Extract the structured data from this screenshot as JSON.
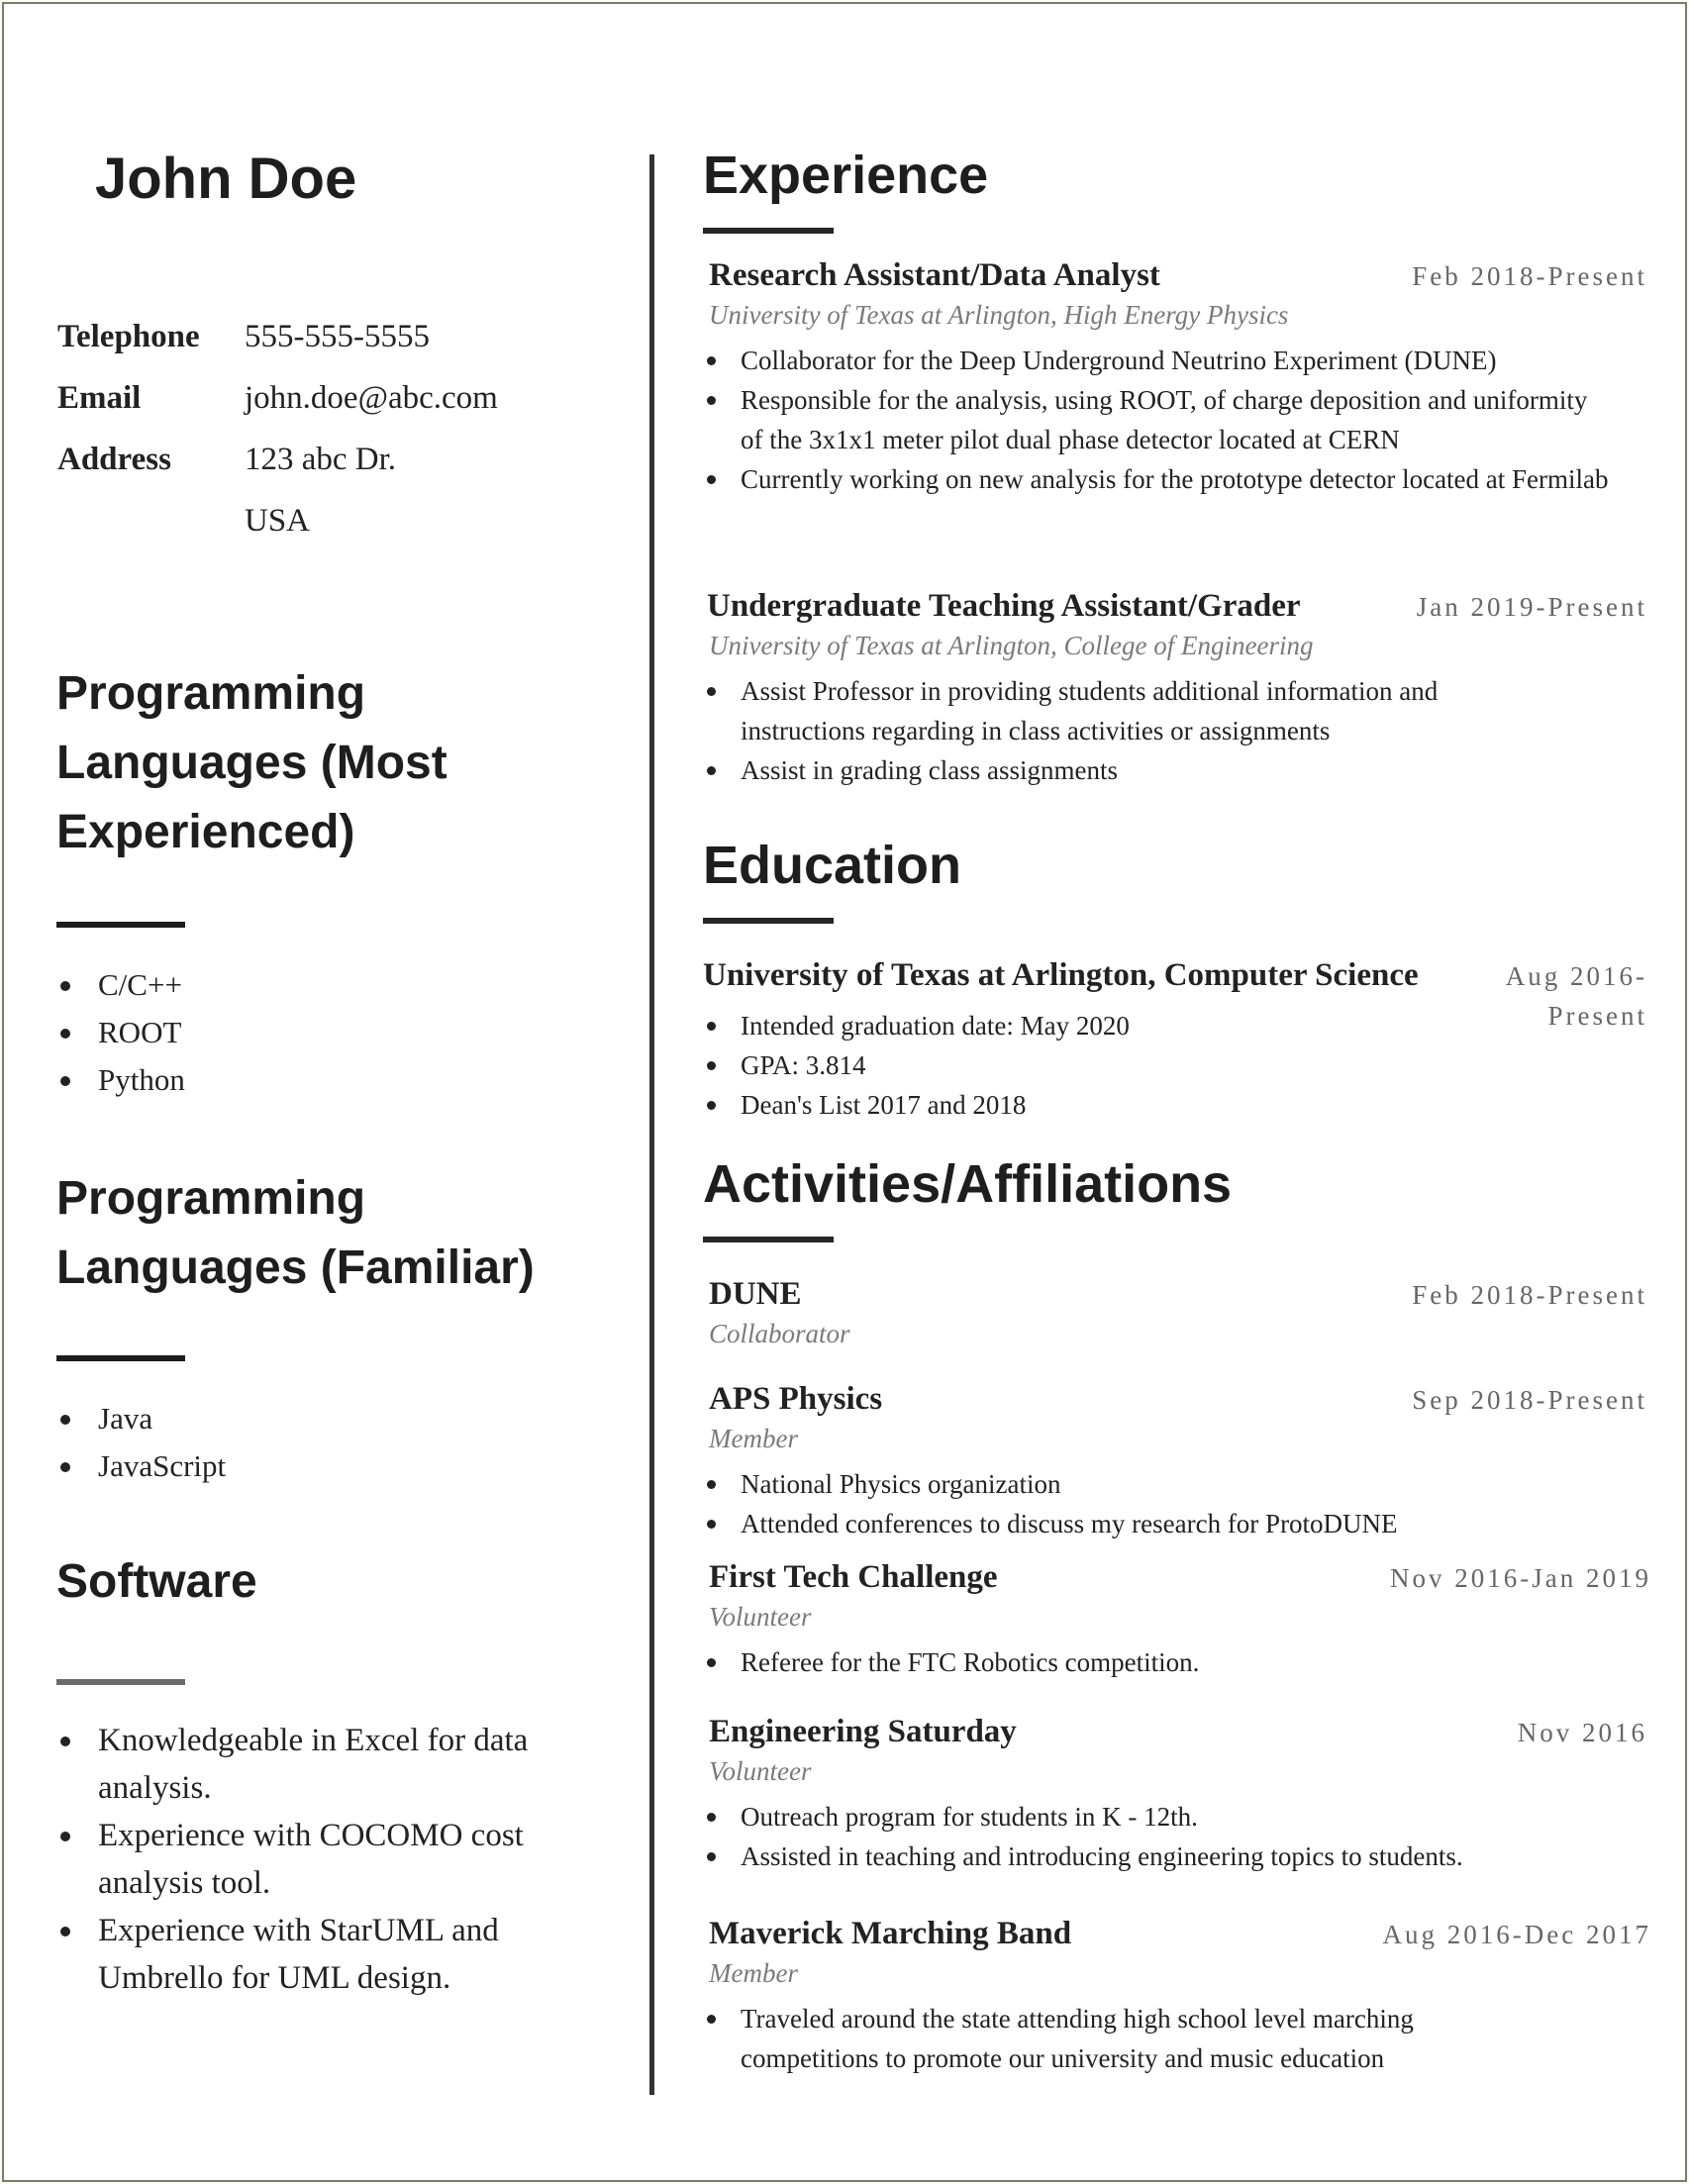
{
  "name": "John Doe",
  "contact": [
    {
      "label": "Telephone",
      "value": "555-555-5555"
    },
    {
      "label": "Email",
      "value": "john.doe@abc.com"
    },
    {
      "label": "Address",
      "value": "123 abc Dr."
    },
    {
      "label": "",
      "value": "USA"
    }
  ],
  "left_sections": {
    "most_experienced": {
      "heading": "Programming Languages (Most Experienced)",
      "items": [
        "C/C++",
        "ROOT",
        "Python"
      ]
    },
    "familiar": {
      "heading": "Programming Languages (Familiar)",
      "items": [
        "Java",
        "JavaScript"
      ]
    },
    "software": {
      "heading": "Software",
      "items": [
        "Knowledgeable in Excel for data analysis.",
        "Experience with COCOMO cost analysis tool.",
        "Experience with StarUML and Umbrello for UML design."
      ]
    }
  },
  "experience": {
    "heading": "Experience",
    "entries": [
      {
        "title": "Research Assistant/Data Analyst",
        "date": "Feb 2018-Present",
        "subtitle": "University of Texas at Arlington, High Energy Physics",
        "bullets": [
          "Collaborator for the Deep Underground Neutrino Experiment (DUNE)",
          "Responsible for the analysis, using ROOT, of charge deposition and uniformity of the 3x1x1 meter pilot dual phase detector located at CERN",
          "Currently working on new analysis for the prototype detector located at Fermilab"
        ]
      },
      {
        "title": "Undergraduate Teaching Assistant/Grader",
        "date": "Jan 2019-Present",
        "subtitle": "University of Texas at Arlington, College of Engineering",
        "bullets": [
          "Assist Professor in providing students additional information and instructions regarding in class activities or assignments",
          "Assist in grading class assignments"
        ]
      }
    ]
  },
  "education": {
    "heading": "Education",
    "entries": [
      {
        "title": "University of Texas at Arlington, Computer Science",
        "date": "Aug 2016-Present",
        "bullets": [
          "Intended graduation date: May 2020",
          "GPA: 3.814",
          "Dean's List 2017 and 2018"
        ]
      }
    ]
  },
  "activities": {
    "heading": "Activities/Affiliations",
    "entries": [
      {
        "title": "DUNE",
        "date": "Feb 2018-Present",
        "subtitle": "Collaborator",
        "bullets": []
      },
      {
        "title": "APS Physics",
        "date": "Sep 2018-Present",
        "subtitle": "Member",
        "bullets": [
          "National Physics organization",
          "Attended conferences to discuss my research for ProtoDUNE"
        ]
      },
      {
        "title": "First Tech Challenge",
        "date": "Nov 2016-Jan 2019",
        "subtitle": "Volunteer",
        "bullets": [
          "Referee for the FTC Robotics competition."
        ]
      },
      {
        "title": "Engineering Saturday",
        "date": "Nov 2016",
        "subtitle": "Volunteer",
        "bullets": [
          "Outreach program for students in K - 12th.",
          "Assisted in teaching and introducing engineering topics to students."
        ]
      },
      {
        "title": "Maverick Marching Band",
        "date": "Aug 2016-Dec 2017",
        "subtitle": "Member",
        "bullets": [
          "Traveled around the state attending high school level marching competitions to promote our university and music education"
        ]
      }
    ]
  }
}
